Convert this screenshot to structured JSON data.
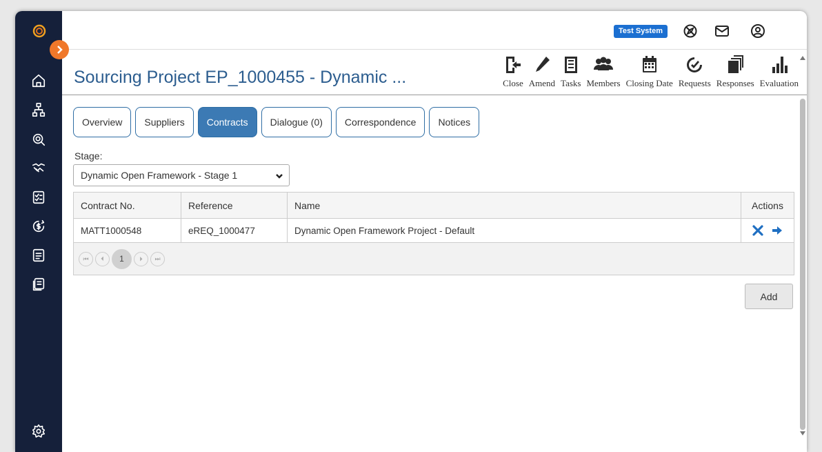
{
  "topbar": {
    "badge": "Test System",
    "icons": [
      "compass-icon",
      "mail-icon",
      "user-icon"
    ]
  },
  "sidebar": {
    "items": [
      "home-icon",
      "network-icon",
      "search-icon",
      "handshake-icon",
      "checklist-icon",
      "currency-icon",
      "document-icon",
      "files-icon",
      "settings-icon"
    ]
  },
  "header": {
    "title": "Sourcing Project EP_1000455 - Dynamic ...",
    "toolbar": [
      {
        "label": "Close",
        "icon": "exit-icon"
      },
      {
        "label": "Amend",
        "icon": "pencil-icon"
      },
      {
        "label": "Tasks",
        "icon": "list-icon"
      },
      {
        "label": "Members",
        "icon": "people-icon"
      },
      {
        "label": "Closing Date",
        "icon": "calendar-icon"
      },
      {
        "label": "Requests",
        "icon": "clock-icon"
      },
      {
        "label": "Responses",
        "icon": "stack-icon"
      },
      {
        "label": "Evaluation",
        "icon": "bar-chart-icon"
      }
    ]
  },
  "tabs": [
    {
      "label": "Overview",
      "active": false
    },
    {
      "label": "Suppliers",
      "active": false
    },
    {
      "label": "Contracts",
      "active": true
    },
    {
      "label": "Dialogue (0)",
      "active": false
    },
    {
      "label": "Correspondence",
      "active": false
    },
    {
      "label": "Notices",
      "active": false
    }
  ],
  "stage": {
    "label": "Stage:",
    "selected": "Dynamic Open Framework - Stage 1"
  },
  "table": {
    "columns": [
      "Contract No.",
      "Reference",
      "Name",
      "Actions"
    ],
    "rows": [
      {
        "contract_no": "MATT1000548",
        "reference": "eREQ_1000477",
        "name": "Dynamic Open Framework Project - Default"
      }
    ],
    "pager": {
      "current_page": "1"
    }
  },
  "add_label": "Add",
  "colors": {
    "sidebar": "#15203a",
    "accent": "#3c7ab4",
    "title": "#2c5d8f",
    "action": "#1f6fc2",
    "expand": "#f0782a"
  }
}
